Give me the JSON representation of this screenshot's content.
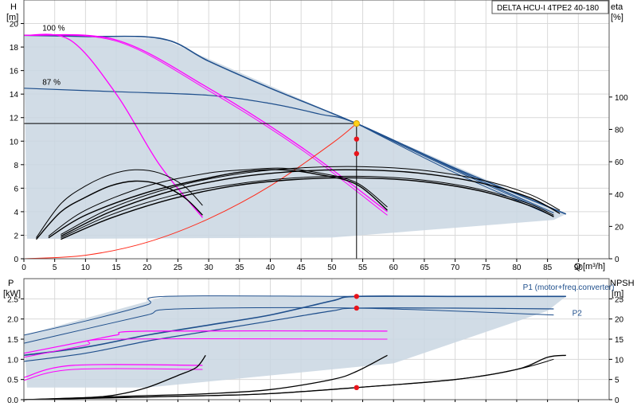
{
  "title": "DELTA HCU-I 4TPE2 40-180",
  "chart_data": [
    {
      "type": "line",
      "name": "H / eta",
      "y_label": "H",
      "y_unit": "[m]",
      "y2_label": "eta",
      "y2_unit": "[%]",
      "x_label": "Q",
      "x_unit": "[m³/h]",
      "xlim": [
        0,
        95
      ],
      "ylim": [
        0,
        22
      ],
      "y2lim": [
        0,
        160
      ],
      "x_ticks": [
        0,
        5,
        10,
        15,
        20,
        25,
        30,
        35,
        40,
        45,
        50,
        55,
        60,
        65,
        70,
        75,
        80,
        85,
        90
      ],
      "y_ticks": [
        0,
        2,
        4,
        6,
        8,
        10,
        12,
        14,
        16,
        18,
        20
      ],
      "y2_ticks": [
        0,
        20,
        40,
        60,
        80,
        100
      ],
      "grid": true,
      "annotations": [
        {
          "text": "100 %",
          "x": 3,
          "y": 19.4
        },
        {
          "text": "87 %",
          "x": 3,
          "y": 14.8
        }
      ],
      "duty_point": {
        "x": 54,
        "y": 11.5
      },
      "eta_markers": [
        {
          "x": 54,
          "y2": 74
        },
        {
          "x": 54,
          "y2": 65
        }
      ],
      "envelope": [
        [
          0,
          19
        ],
        [
          22.5,
          18.7
        ],
        [
          54,
          11.5
        ],
        [
          88,
          3.8
        ],
        [
          86,
          3.3
        ],
        [
          50,
          1.8
        ],
        [
          10,
          1.7
        ],
        [
          0.5,
          1.7
        ]
      ],
      "series": [
        {
          "role": "pump",
          "color": "#1f4f8c",
          "width": 1.6,
          "points": [
            [
              0,
              19
            ],
            [
              10,
              18.9
            ],
            [
              22.5,
              18.7
            ],
            [
              30,
              16.8
            ],
            [
              40,
              14.5
            ],
            [
              54,
              11.5
            ],
            [
              70,
              7.7
            ],
            [
              88,
              3.8
            ]
          ]
        },
        {
          "role": "pump",
          "color": "#1f4f8c",
          "width": 1.2,
          "points": [
            [
              0,
              14.5
            ],
            [
              15,
              14.2
            ],
            [
              30,
              13.9
            ],
            [
              40,
              13.2
            ],
            [
              48,
              12.3
            ],
            [
              54,
              11.5
            ],
            [
              70,
              7.6
            ],
            [
              86,
              3.9
            ]
          ]
        },
        {
          "role": "pump",
          "color": "#1f4f8c",
          "width": 1.0,
          "points": [
            [
              54,
              11.5
            ],
            [
              70,
              7.5
            ],
            [
              85,
              4.0
            ]
          ]
        },
        {
          "role": "pump",
          "color": "#1f4f8c",
          "width": 1.0,
          "points": [
            [
              54,
              11.5
            ],
            [
              70,
              7.3
            ],
            [
              86,
              3.6
            ]
          ]
        },
        {
          "role": "limit",
          "color": "#ff00ff",
          "width": 1.3,
          "points": [
            [
              0,
              19
            ],
            [
              7.5,
              18.6
            ],
            [
              15,
              14
            ],
            [
              22,
              8
            ],
            [
              29,
              3.5
            ]
          ]
        },
        {
          "role": "limit",
          "color": "#ff00ff",
          "width": 1.3,
          "points": [
            [
              0,
              19
            ],
            [
              15,
              18.6
            ],
            [
              30,
              14.5
            ],
            [
              45,
              9.5
            ],
            [
              59,
              4
            ]
          ]
        },
        {
          "role": "limit",
          "color": "#ff00ff",
          "width": 1.0,
          "points": [
            [
              0,
              19
            ],
            [
              15,
              18.5
            ],
            [
              30,
              14.3
            ],
            [
              45,
              9.3
            ],
            [
              59,
              3.7
            ]
          ]
        },
        {
          "role": "system",
          "color": "#ff2a1a",
          "width": 1.0,
          "points": [
            [
              0,
              0
            ],
            [
              10,
              0.3
            ],
            [
              20,
              1.4
            ],
            [
              30,
              3.4
            ],
            [
              40,
              6.2
            ],
            [
              50,
              9.8
            ],
            [
              54,
              11.5
            ]
          ]
        },
        {
          "role": "eta",
          "color": "#000000",
          "width": 1.4,
          "points": [
            [
              2,
              12
            ],
            [
              6,
              29
            ],
            [
              10,
              38
            ],
            [
              14,
              45
            ],
            [
              18,
              48
            ],
            [
              22,
              46
            ],
            [
              26,
              38
            ],
            [
              29,
              27
            ]
          ]
        },
        {
          "role": "eta",
          "color": "#000000",
          "width": 1.0,
          "points": [
            [
              2,
              13
            ],
            [
              6,
              34
            ],
            [
              10,
              45
            ],
            [
              14,
              52
            ],
            [
              18,
              55
            ],
            [
              22,
              53
            ],
            [
              26,
              45
            ],
            [
              29,
              33
            ]
          ]
        },
        {
          "role": "eta",
          "color": "#000000",
          "width": 1.4,
          "points": [
            [
              4,
              13
            ],
            [
              10,
              27
            ],
            [
              20,
              41
            ],
            [
              30,
              50
            ],
            [
              36,
              54
            ],
            [
              42,
              55
            ],
            [
              48,
              52
            ],
            [
              54,
              46
            ],
            [
              59,
              30
            ]
          ]
        },
        {
          "role": "eta",
          "color": "#000000",
          "width": 1.0,
          "points": [
            [
              4,
              14
            ],
            [
              10,
              30
            ],
            [
              20,
              45
            ],
            [
              30,
              53
            ],
            [
              36,
              55
            ],
            [
              42,
              56
            ],
            [
              48,
              53
            ],
            [
              54,
              47
            ],
            [
              59,
              32
            ]
          ]
        },
        {
          "role": "eta",
          "color": "#000000",
          "width": 1.4,
          "points": [
            [
              6,
              12
            ],
            [
              14,
              25
            ],
            [
              24,
              37
            ],
            [
              34,
              45
            ],
            [
              44,
              49
            ],
            [
              54,
              50
            ],
            [
              64,
              48
            ],
            [
              74,
              42
            ],
            [
              82,
              33
            ],
            [
              86,
              26
            ]
          ]
        },
        {
          "role": "eta",
          "color": "#000000",
          "width": 1.0,
          "points": [
            [
              6,
              13
            ],
            [
              14,
              27
            ],
            [
              24,
              39
            ],
            [
              34,
              46
            ],
            [
              44,
              50
            ],
            [
              54,
              51
            ],
            [
              64,
              49
            ],
            [
              74,
              43
            ],
            [
              82,
              34
            ],
            [
              86,
              27
            ]
          ]
        },
        {
          "role": "eta",
          "color": "#000000",
          "width": 1.4,
          "points": [
            [
              6,
              14
            ],
            [
              14,
              29
            ],
            [
              24,
              42
            ],
            [
              34,
              50
            ],
            [
              44,
              54
            ],
            [
              54,
              55
            ],
            [
              64,
              53
            ],
            [
              74,
              47
            ],
            [
              82,
              38
            ],
            [
              87,
              28
            ]
          ]
        },
        {
          "role": "eta",
          "color": "#000000",
          "width": 1.0,
          "points": [
            [
              6,
              15
            ],
            [
              14,
              31
            ],
            [
              24,
              44
            ],
            [
              34,
              52
            ],
            [
              44,
              56
            ],
            [
              54,
              57
            ],
            [
              64,
              55
            ],
            [
              74,
              49
            ],
            [
              82,
              40
            ],
            [
              87,
              30
            ]
          ]
        }
      ]
    },
    {
      "type": "line",
      "name": "P / NPSH",
      "y_label": "P",
      "y_unit": "[kW]",
      "y2_label": "NPSH",
      "y2_unit": "[m]",
      "xlim": [
        0,
        95
      ],
      "ylim": [
        0,
        3.0
      ],
      "y2lim": [
        0,
        30
      ],
      "y_ticks": [
        0,
        0.5,
        1.0,
        1.5,
        2.0,
        2.5
      ],
      "y_tick_labels": [
        "0.0",
        "0.5",
        "1.0",
        "1.5",
        "2.0",
        "2.5"
      ],
      "y2_ticks": [
        0,
        5,
        10,
        15,
        20,
        25
      ],
      "grid": true,
      "series_labels": [
        {
          "text": "P1 (motor+freq.converter)",
          "x": 81,
          "y": 2.72
        },
        {
          "text": "P2",
          "x": 89,
          "y": 2.08
        }
      ],
      "markers": [
        {
          "x": 54,
          "y": 2.56
        },
        {
          "x": 54,
          "y": 2.27
        },
        {
          "x": 54,
          "y": 0.3
        }
      ],
      "envelope": [
        [
          0,
          1.6
        ],
        [
          23,
          2.56
        ],
        [
          88,
          2.56
        ],
        [
          85,
          2.2
        ],
        [
          60,
          0.9
        ],
        [
          20,
          0.3
        ],
        [
          0.5,
          0.3
        ]
      ],
      "series": [
        {
          "color": "#1f4f8c",
          "width": 1.6,
          "points": [
            [
              0,
              1.1
            ],
            [
              10,
              1.3
            ],
            [
              20,
              1.6
            ],
            [
              30,
              1.85
            ],
            [
              40,
              2.1
            ],
            [
              50,
              2.45
            ],
            [
              54,
              2.56
            ],
            [
              70,
              2.56
            ],
            [
              88,
              2.56
            ]
          ]
        },
        {
          "color": "#1f4f8c",
          "width": 1.2,
          "points": [
            [
              0,
              0.95
            ],
            [
              10,
              1.15
            ],
            [
              20,
              1.45
            ],
            [
              30,
              1.7
            ],
            [
              40,
              1.95
            ],
            [
              50,
              2.2
            ],
            [
              54,
              2.27
            ],
            [
              70,
              2.27
            ],
            [
              86,
              2.25
            ]
          ]
        },
        {
          "color": "#1f4f8c",
          "width": 1.0,
          "points": [
            [
              0,
              1.6
            ],
            [
              10,
              1.95
            ],
            [
              20,
              2.35
            ],
            [
              23,
              2.56
            ],
            [
              54,
              2.56
            ],
            [
              88,
              2.56
            ]
          ]
        },
        {
          "color": "#1f4f8c",
          "width": 1.0,
          "points": [
            [
              0,
              1.4
            ],
            [
              10,
              1.75
            ],
            [
              20,
              2.1
            ],
            [
              25,
              2.25
            ],
            [
              54,
              2.27
            ],
            [
              86,
              2.1
            ]
          ]
        },
        {
          "color": "#ff00ff",
          "width": 1.2,
          "points": [
            [
              0,
              1.15
            ],
            [
              10,
              1.45
            ],
            [
              15,
              1.6
            ],
            [
              20,
              1.7
            ],
            [
              59,
              1.7
            ]
          ]
        },
        {
          "color": "#ff00ff",
          "width": 1.0,
          "points": [
            [
              0,
              1.05
            ],
            [
              10,
              1.35
            ],
            [
              15,
              1.5
            ],
            [
              59,
              1.5
            ]
          ]
        },
        {
          "color": "#ff00ff",
          "width": 1.2,
          "points": [
            [
              0,
              0.55
            ],
            [
              8,
              0.85
            ],
            [
              29,
              0.85
            ]
          ]
        },
        {
          "color": "#ff00ff",
          "width": 1.0,
          "points": [
            [
              0,
              0.48
            ],
            [
              8,
              0.75
            ],
            [
              29,
              0.75
            ]
          ]
        },
        {
          "color": "#000000",
          "width": 1.3,
          "points": [
            [
              0,
              0.0
            ],
            [
              10,
              0.05
            ],
            [
              15,
              0.12
            ],
            [
              20,
              0.3
            ],
            [
              25,
              0.6
            ],
            [
              28,
              0.8
            ],
            [
              29.5,
              1.1
            ]
          ]
        },
        {
          "color": "#000000",
          "width": 1.3,
          "points": [
            [
              0,
              0.0
            ],
            [
              20,
              0.1
            ],
            [
              30,
              0.15
            ],
            [
              40,
              0.25
            ],
            [
              50,
              0.5
            ],
            [
              54,
              0.7
            ],
            [
              59,
              1.1
            ]
          ]
        },
        {
          "color": "#000000",
          "width": 1.3,
          "points": [
            [
              0,
              0.0
            ],
            [
              30,
              0.1
            ],
            [
              40,
              0.15
            ],
            [
              54,
              0.3
            ],
            [
              70,
              0.5
            ],
            [
              80,
              0.75
            ],
            [
              85,
              1.05
            ],
            [
              88,
              1.1
            ]
          ]
        },
        {
          "color": "#000000",
          "width": 1.0,
          "points": [
            [
              0,
              0.0
            ],
            [
              30,
              0.1
            ],
            [
              40,
              0.15
            ],
            [
              54,
              0.3
            ],
            [
              70,
              0.5
            ],
            [
              80,
              0.75
            ],
            [
              86,
              1.0
            ]
          ]
        }
      ]
    }
  ]
}
